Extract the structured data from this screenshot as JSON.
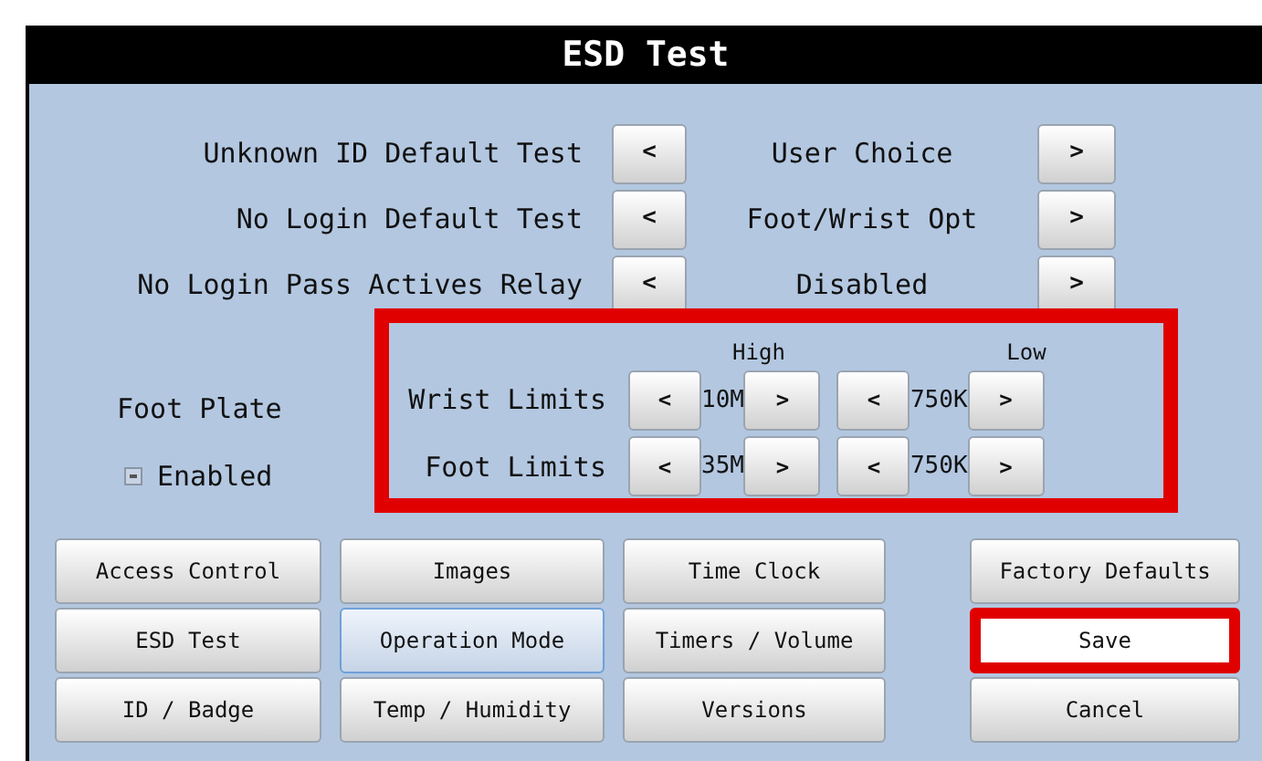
{
  "window": {
    "title": "ESD Test"
  },
  "settings": [
    {
      "label": "Unknown ID Default Test",
      "prev": "<",
      "value": "User Choice",
      "next": ">"
    },
    {
      "label": "No Login Default Test",
      "prev": "<",
      "value": "Foot/Wrist Opt",
      "next": ">"
    },
    {
      "label": "No Login Pass Actives Relay",
      "prev": "<",
      "value": "Disabled",
      "next": ">"
    }
  ],
  "foot_plate": {
    "label": "Foot Plate",
    "enabled": {
      "label": "Enabled",
      "checked": true
    }
  },
  "limits": {
    "highlighted": true,
    "headers": [
      "High",
      "Low"
    ],
    "rows": [
      {
        "label": "Wrist Limits",
        "high": {
          "prev": "<",
          "value": "10M",
          "next": ">"
        },
        "low": {
          "prev": "<",
          "value": "750K",
          "next": ">"
        }
      },
      {
        "label": "Foot Limits",
        "high": {
          "prev": "<",
          "value": "35M",
          "next": ">"
        },
        "low": {
          "prev": "<",
          "value": "750K",
          "next": ">"
        }
      }
    ]
  },
  "nav_buttons": [
    {
      "label": "Access Control",
      "selected": false
    },
    {
      "label": "Images",
      "selected": false
    },
    {
      "label": "Time Clock",
      "selected": false
    },
    {
      "label": "ESD Test",
      "selected": false
    },
    {
      "label": "Operation Mode",
      "selected": true
    },
    {
      "label": "Timers / Volume",
      "selected": false
    },
    {
      "label": "ID / Badge",
      "selected": false
    },
    {
      "label": "Temp / Humidity",
      "selected": false
    },
    {
      "label": "Versions",
      "selected": false
    }
  ],
  "actions": [
    {
      "label": "Factory Defaults",
      "highlighted": false
    },
    {
      "label": "Save",
      "highlighted": true
    },
    {
      "label": "Cancel",
      "highlighted": false
    }
  ]
}
